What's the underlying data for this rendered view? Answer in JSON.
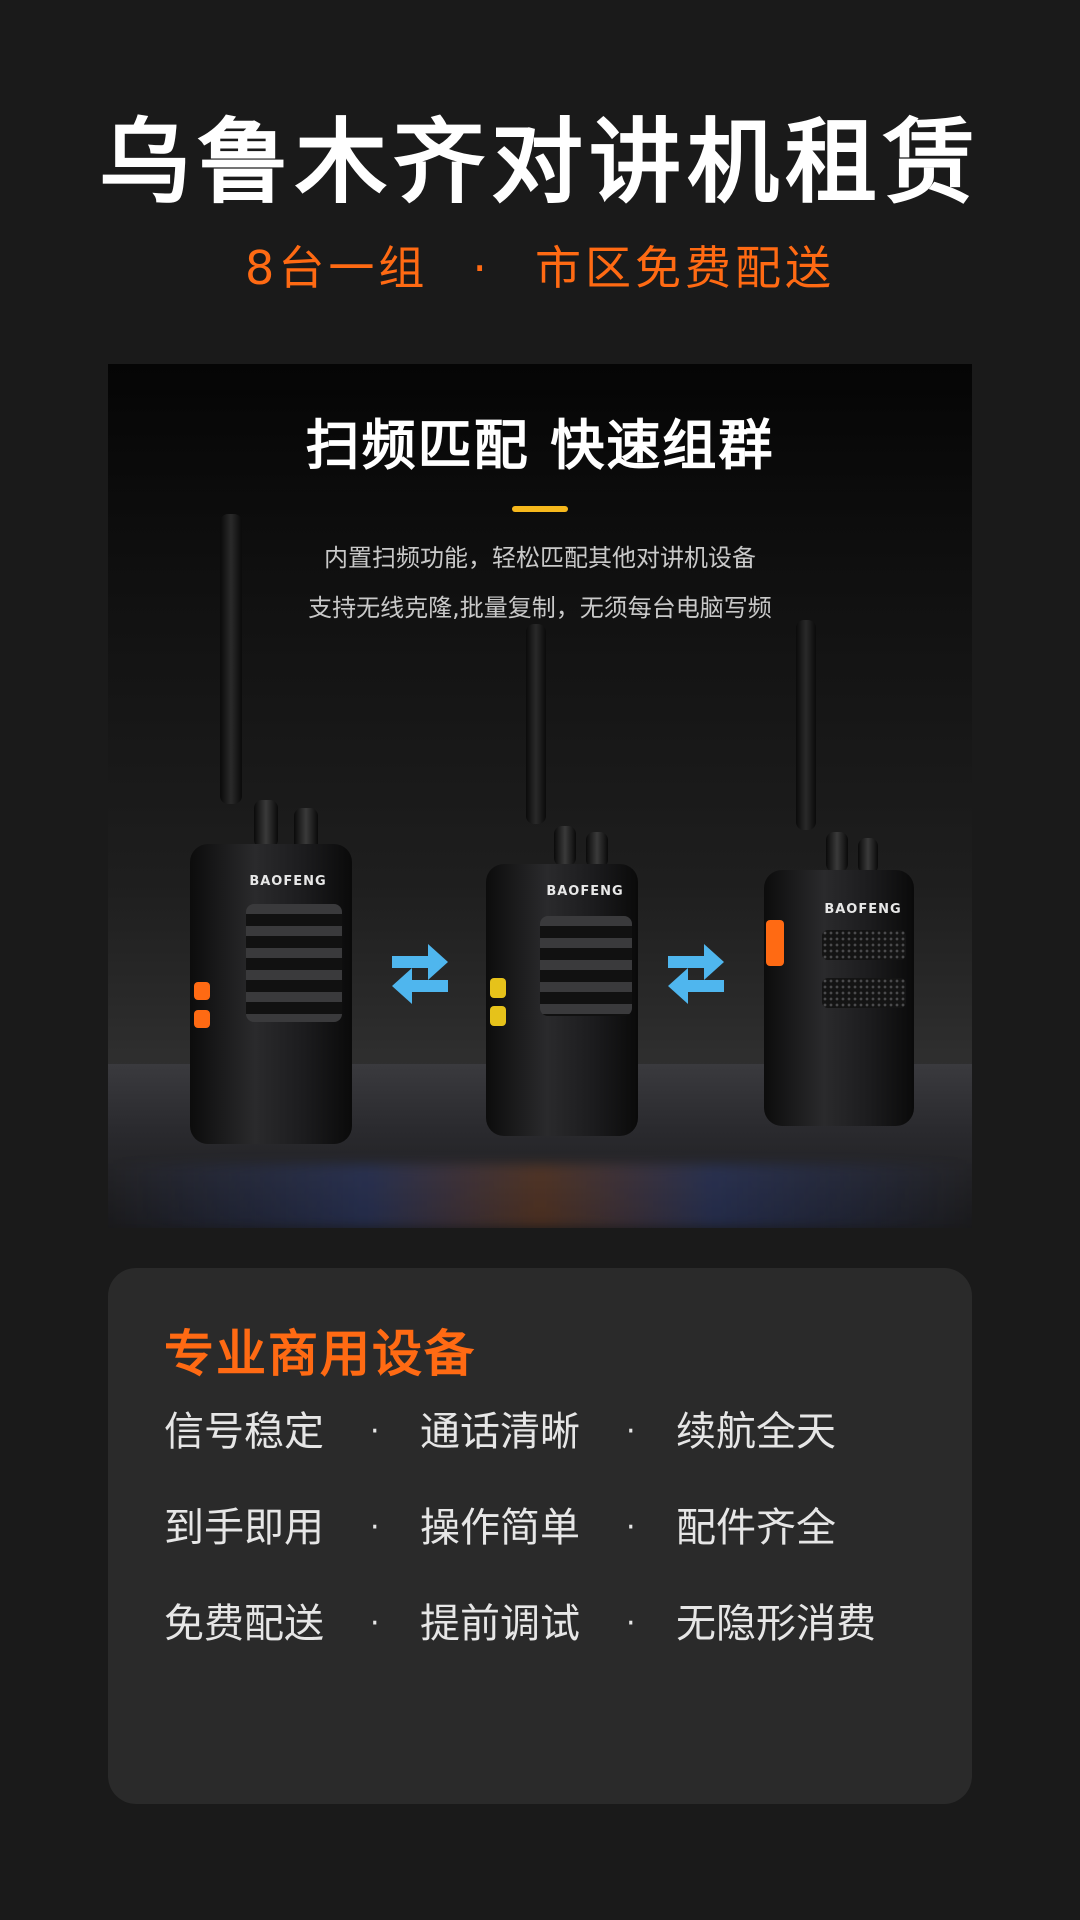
{
  "header": {
    "title": "乌鲁木齐对讲机租赁",
    "subtitle_left": "8台一组",
    "subtitle_sep": "·",
    "subtitle_right": "市区免费配送"
  },
  "photo": {
    "heading": "扫频匹配 快速组群",
    "line1": "内置扫频功能，轻松匹配其他对讲机设备",
    "line2": "支持无线克隆,批量复制，无须每台电脑写频",
    "brand": "BAOFENG",
    "accent_bar_color": "#f6b81c"
  },
  "features": {
    "title": "专业商用设备",
    "separator": "·",
    "rows": [
      [
        "信号稳定",
        "通话清晰",
        "续航全天"
      ],
      [
        "到手即用",
        "操作简单",
        "配件齐全"
      ],
      [
        "免费配送",
        "提前调试",
        "无隐形消费"
      ]
    ]
  },
  "colors": {
    "background": "#1a1a1a",
    "accent": "#ff6a13",
    "card": "#2a2a2a",
    "arrow": "#4fb6ee"
  }
}
